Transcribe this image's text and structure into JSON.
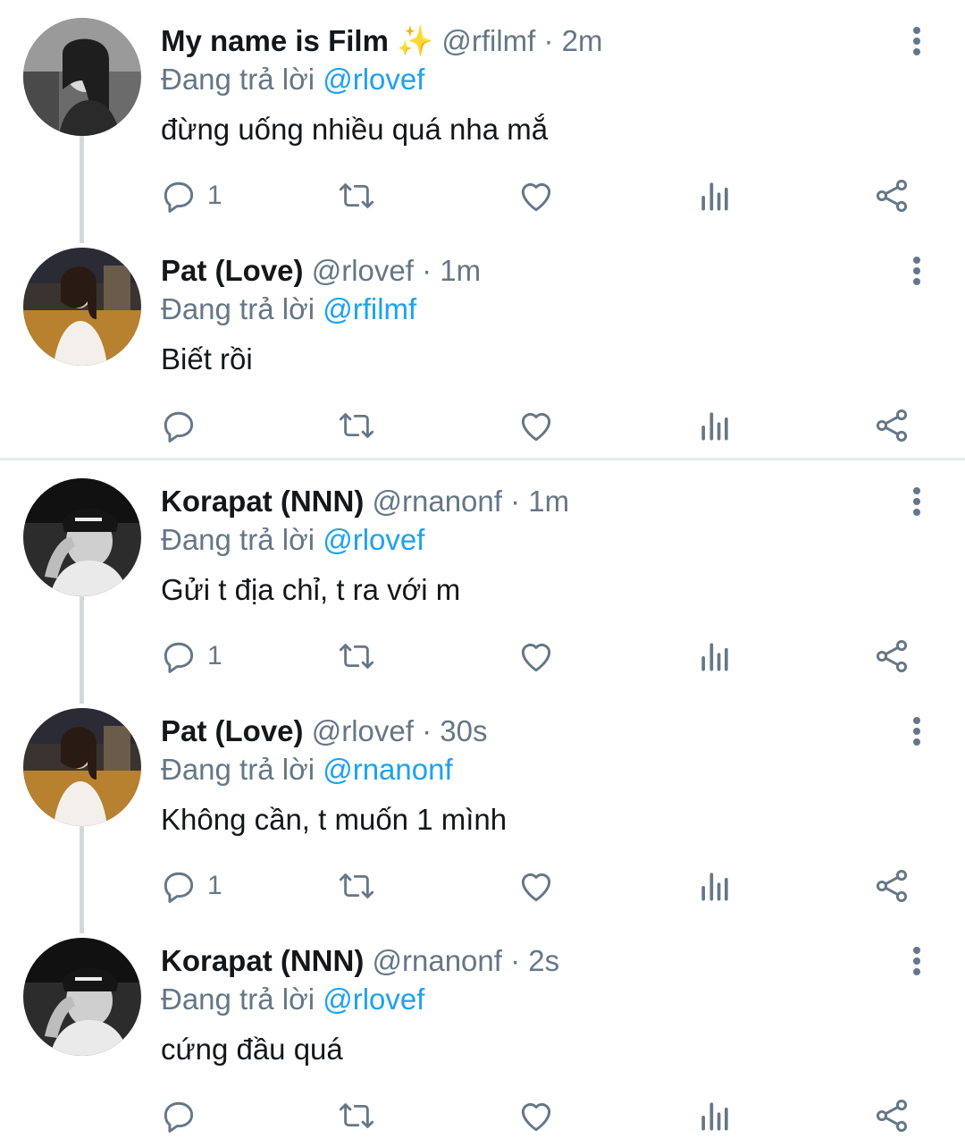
{
  "colors": {
    "name": "#14171a",
    "meta": "#657786",
    "mention": "#1da1f2",
    "divider": "#e6ecf0",
    "thread": "#d4d8db"
  },
  "tweets": [
    {
      "name": "My name is Film",
      "emoji": "✨",
      "handle": "@rfilmf",
      "time": "· 2m",
      "replying_prefix": "Đang trả lời",
      "replying_to": "@rlovef",
      "text": "đừng uống nhiều quá nha mắ",
      "reply_count": "1"
    },
    {
      "name": "Pat (Love)",
      "emoji": "",
      "handle": "@rlovef",
      "time": "· 1m",
      "replying_prefix": "Đang trả lời",
      "replying_to": "@rfilmf",
      "text": "Biết rồi",
      "reply_count": ""
    },
    {
      "name": "Korapat (NNN)",
      "emoji": "",
      "handle": "@rnanonf",
      "time": "· 1m",
      "replying_prefix": "Đang trả lời",
      "replying_to": "@rlovef",
      "text": "Gửi t địa chỉ, t ra với m",
      "reply_count": "1"
    },
    {
      "name": "Pat (Love)",
      "emoji": "",
      "handle": "@rlovef",
      "time": "· 30s",
      "replying_prefix": "Đang trả lời",
      "replying_to": "@rnanonf",
      "text": "Không cần, t muốn 1 mình",
      "reply_count": "1"
    },
    {
      "name": "Korapat (NNN)",
      "emoji": "",
      "handle": "@rnanonf",
      "time": "· 2s",
      "replying_prefix": "Đang trả lời",
      "replying_to": "@rlovef",
      "text": "cứng đầu quá",
      "reply_count": ""
    }
  ],
  "icons": {
    "reply": "reply-icon",
    "retweet": "retweet-icon",
    "like": "heart-icon",
    "analytics": "analytics-icon",
    "share": "share-icon",
    "more": "more-vertical-icon"
  }
}
